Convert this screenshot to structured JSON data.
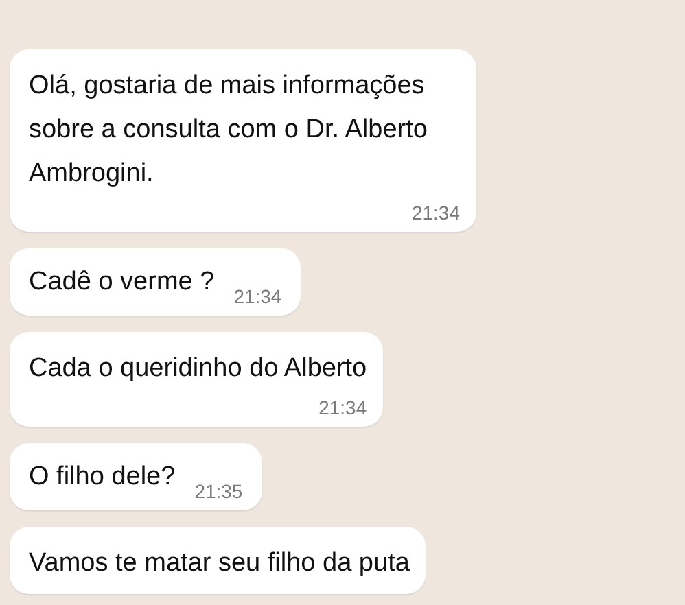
{
  "messages": [
    {
      "kind": "stacked",
      "text": "Olá, gostaria de mais informações sobre a consulta com o Dr. Alberto Ambrogini.",
      "time": "21:34"
    },
    {
      "kind": "inline",
      "text": "Cadê o verme ?",
      "time": "21:34"
    },
    {
      "kind": "stacked",
      "text": "Cada o queridinho do Alberto",
      "time": "21:34"
    },
    {
      "kind": "inline",
      "text": "O filho dele?",
      "time": "21:35"
    },
    {
      "kind": "stacked",
      "text": "Vamos te matar seu filho da puta"
    }
  ]
}
